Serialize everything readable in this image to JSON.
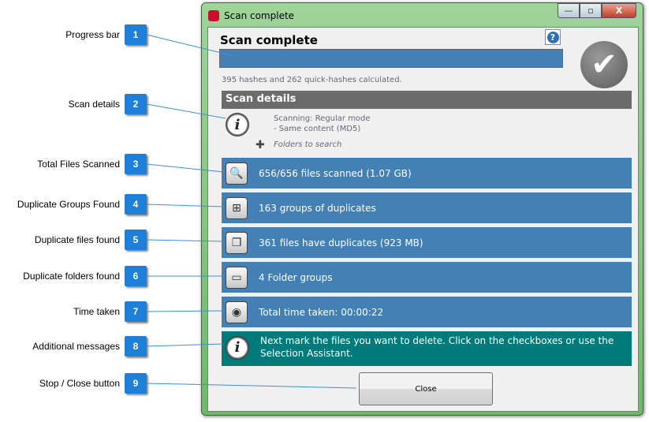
{
  "callouts": [
    {
      "n": "1",
      "label": "Progress bar"
    },
    {
      "n": "2",
      "label": "Scan details"
    },
    {
      "n": "3",
      "label": "Total Files Scanned"
    },
    {
      "n": "4",
      "label": "Duplicate Groups Found"
    },
    {
      "n": "5",
      "label": "Duplicate files found"
    },
    {
      "n": "6",
      "label": "Duplicate folders found"
    },
    {
      "n": "7",
      "label": "Time taken"
    },
    {
      "n": "8",
      "label": "Additional messages"
    },
    {
      "n": "9",
      "label": "Stop / Close button"
    }
  ],
  "window": {
    "title": "Scan complete",
    "minimize": "—",
    "maximize": "▫",
    "close": "X"
  },
  "header": {
    "title": "Scan complete",
    "help": "?",
    "progress_percent": 100
  },
  "hashes": "395 hashes and 262 quick-hashes calculated.",
  "scan_details": {
    "title": "Scan details",
    "line1": "Scanning: Regular mode",
    "line2": "- Same content (MD5)",
    "folders": "Folders to search"
  },
  "rows": [
    {
      "icon": "magnifier-icon",
      "glyph": "🔍",
      "text": "656/656 files scanned (1.07 GB)"
    },
    {
      "icon": "hierarchy-icon",
      "glyph": "⊞",
      "text": "163 groups of duplicates"
    },
    {
      "icon": "files-icon",
      "glyph": "❐",
      "text": "361 files have duplicates (923 MB)"
    },
    {
      "icon": "folder-icon",
      "glyph": "▭",
      "text": "4 Folder groups"
    },
    {
      "icon": "stopwatch-icon",
      "glyph": "◉",
      "text": "Total time taken: 00:00:22"
    }
  ],
  "message": "Next mark the files you want to delete. Click on the checkboxes or use the Selection Assistant.",
  "close_label": "Close",
  "colors": {
    "row_blue": "#4580b4",
    "message_teal": "#007b7a",
    "badge": "#1e7fd8",
    "header_gray": "#6b6b6b"
  }
}
